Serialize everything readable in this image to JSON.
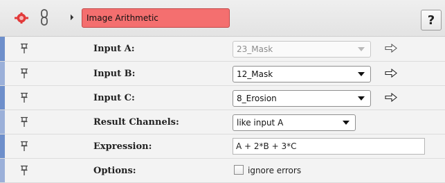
{
  "header": {
    "title": "Image Arithmetic",
    "help_label": "?"
  },
  "colors": {
    "title_bg": "#f46f6f",
    "module_icon": "#e23a3a",
    "row_accent": "#6e8fcb"
  },
  "fields": {
    "input_a": {
      "label": "Input A:",
      "value": "23_Mask"
    },
    "input_b": {
      "label": "Input B:",
      "value": "12_Mask"
    },
    "input_c": {
      "label": "Input C:",
      "value": "8_Erosion"
    },
    "result_channels": {
      "label": "Result Channels:",
      "value": "like input A"
    },
    "expression": {
      "label": "Expression:",
      "value": "A + 2*B + 3*C"
    },
    "options": {
      "label": "Options:",
      "checkbox_label": "ignore errors",
      "checked": false
    }
  },
  "icons": [
    "module-gear-icon",
    "chain-link-icon",
    "collapse-arrow-icon",
    "pin-icon",
    "arrow-right-icon"
  ]
}
